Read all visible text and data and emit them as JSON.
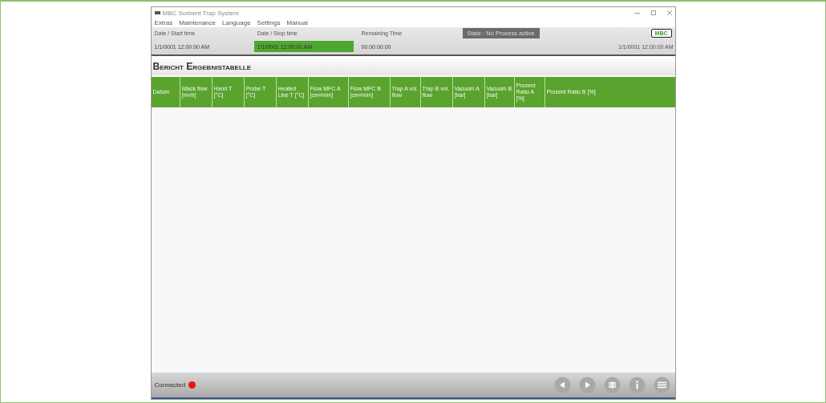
{
  "window": {
    "title": "MBC Sorbent Trap System"
  },
  "menu": [
    "Extras",
    "Maintenance",
    "Language",
    "Settings",
    "Manual"
  ],
  "status": {
    "start_label": "Date / Start time",
    "stop_label": "Date / Stop time",
    "remaining_label": "Remaining Time",
    "start_value": "1/1/0001 12:00:00 AM",
    "stop_value": "1/1/0001 12:00:00 AM",
    "remaining_value": "00:00:00:00",
    "state": "State : No Process active",
    "logo": "MBC",
    "clock": "1/1/0001 12:00:00 AM"
  },
  "heading": "Bericht Ergebnistabelle",
  "table": {
    "columns": [
      {
        "label": "Datum"
      },
      {
        "label": "Stack flow [m³/h]"
      },
      {
        "label": "Hand T [°C]"
      },
      {
        "label": "Probe T [°C]"
      },
      {
        "label": "Heated Line T [°C]"
      },
      {
        "label": "Flow MFC A [cm³/min]"
      },
      {
        "label": "Flow MFC B [cm³/min]"
      },
      {
        "label": "Trap A vol. flow"
      },
      {
        "label": "Trap B vol. flow"
      },
      {
        "label": "Vacuum A [bar]"
      },
      {
        "label": "Vacuum B [bar]"
      },
      {
        "label": "Prozent Ratio A [%]"
      },
      {
        "label": "Prozent Ratio B [%]"
      }
    ]
  },
  "footer": {
    "connection": "Connected",
    "connected": false
  }
}
